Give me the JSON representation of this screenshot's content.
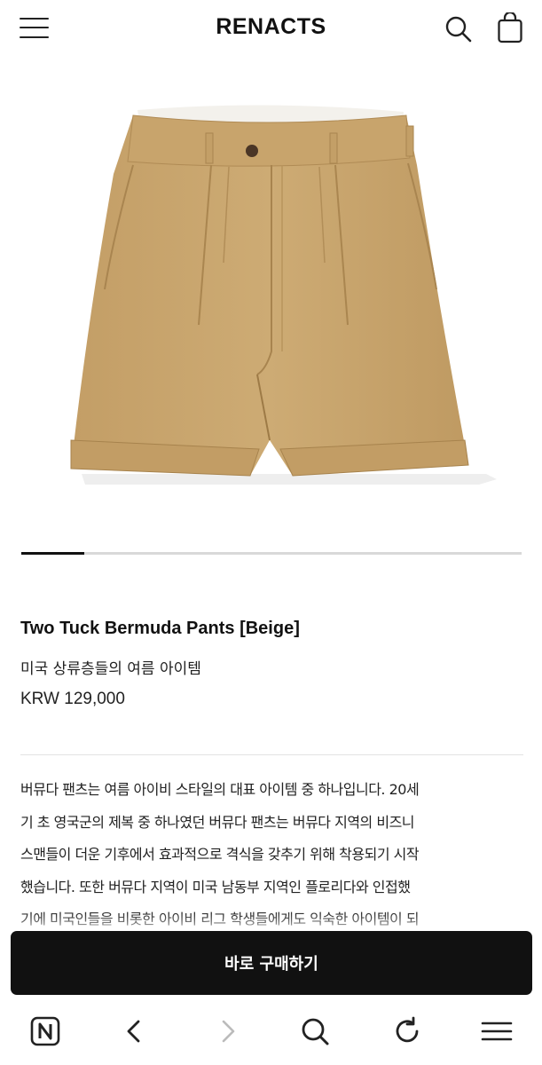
{
  "header": {
    "brand": "RENACTS",
    "menu_icon": "hamburger-menu-icon",
    "search_icon": "search-icon",
    "bag_icon": "shopping-bag-icon"
  },
  "gallery": {
    "image_subject": "beige two tuck bermuda shorts",
    "current_slide_fraction": 0.125
  },
  "product": {
    "title": "Two Tuck Bermuda Pants [Beige]",
    "subtitle": "미국 상류층들의 여름 아이템",
    "price": "KRW 129,000"
  },
  "description": {
    "lines": [
      "버뮤다 팬츠는 여름 아이비 스타일의 대표 아이템 중 하나입니다. 20세",
      "기 초 영국군의 제복 중 하나였던 버뮤다 팬츠는 버뮤다 지역의 비즈니",
      "스맨들이 더운 기후에서 효과적으로 격식을 갖추기 위해 착용되기 시작",
      "했습니다. 또한 버뮤다 지역이 미국 남동부 지역인 플로리다와 인접했",
      "기에 미국인들을 비롯한 아이비 리그 학생들에게도 익숙한 아이템이 되"
    ]
  },
  "cta": {
    "buy_now": "바로 구매하기"
  },
  "browser_toolbar": {
    "icons": [
      "naver-n-icon",
      "back-arrow-icon",
      "forward-arrow-icon",
      "search-icon",
      "refresh-icon",
      "menu-icon"
    ]
  },
  "colors": {
    "text": "#111111",
    "button_bg": "#111111",
    "shorts_beige": "#C9A56E",
    "disabled": "#BBBBBB"
  }
}
